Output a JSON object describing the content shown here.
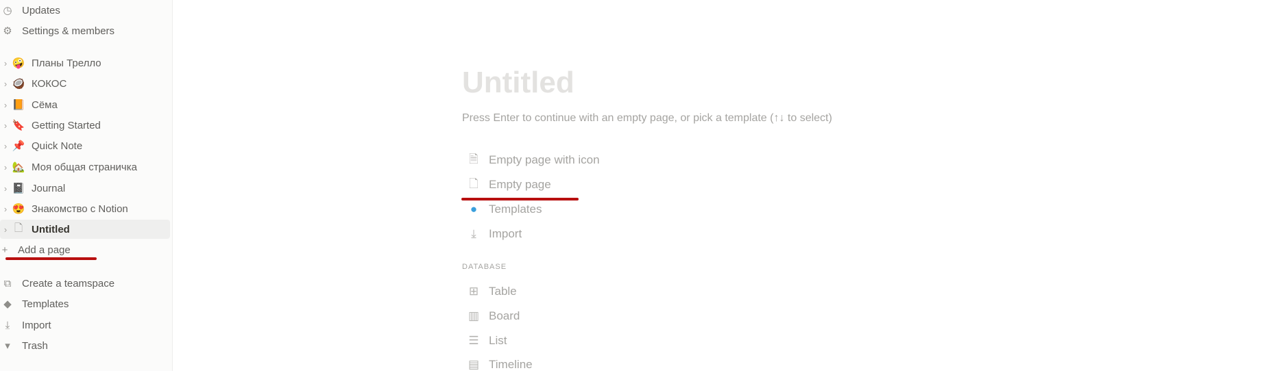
{
  "sidebar": {
    "top": [
      {
        "label": "Updates",
        "icon": "clock-icon"
      },
      {
        "label": "Settings & members",
        "icon": "gear-icon"
      }
    ],
    "pages": [
      {
        "label": "Планы Трелло",
        "emoji": "🤪"
      },
      {
        "label": "КОКОС",
        "emoji": "🥥"
      },
      {
        "label": "Сёма",
        "emoji": "📙"
      },
      {
        "label": "Getting Started",
        "emoji": "🔖"
      },
      {
        "label": "Quick Note",
        "emoji": "📌"
      },
      {
        "label": "Моя общая страничка",
        "emoji": "🏡"
      },
      {
        "label": "Journal",
        "emoji": "📓"
      },
      {
        "label": "Знакомство с Notion",
        "emoji": "😍"
      },
      {
        "label": "Untitled",
        "emoji": "🗋",
        "selected": true
      }
    ],
    "add_page": "Add a page",
    "bottom": [
      {
        "label": "Create a teamspace",
        "icon": "teamspace-icon"
      },
      {
        "label": "Templates",
        "icon": "templates-icon"
      },
      {
        "label": "Import",
        "icon": "import-icon"
      },
      {
        "label": "Trash",
        "icon": "trash-icon"
      }
    ]
  },
  "main": {
    "title_placeholder": "Untitled",
    "hint": "Press Enter to continue with an empty page, or pick a template (↑↓ to select)",
    "options": [
      {
        "label": "Empty page with icon",
        "icon": "page-with-lines-icon"
      },
      {
        "label": "Empty page",
        "icon": "page-icon"
      },
      {
        "label": "Templates",
        "icon": "templates-icon"
      },
      {
        "label": "Import",
        "icon": "import-icon"
      }
    ],
    "database_header": "DATABASE",
    "database": [
      {
        "label": "Table",
        "icon": "table-icon"
      },
      {
        "label": "Board",
        "icon": "board-icon"
      },
      {
        "label": "List",
        "icon": "list-icon"
      },
      {
        "label": "Timeline",
        "icon": "timeline-icon"
      }
    ]
  },
  "colors": {
    "annotation": "#b80f0f",
    "selected_bg": "#efefee"
  }
}
